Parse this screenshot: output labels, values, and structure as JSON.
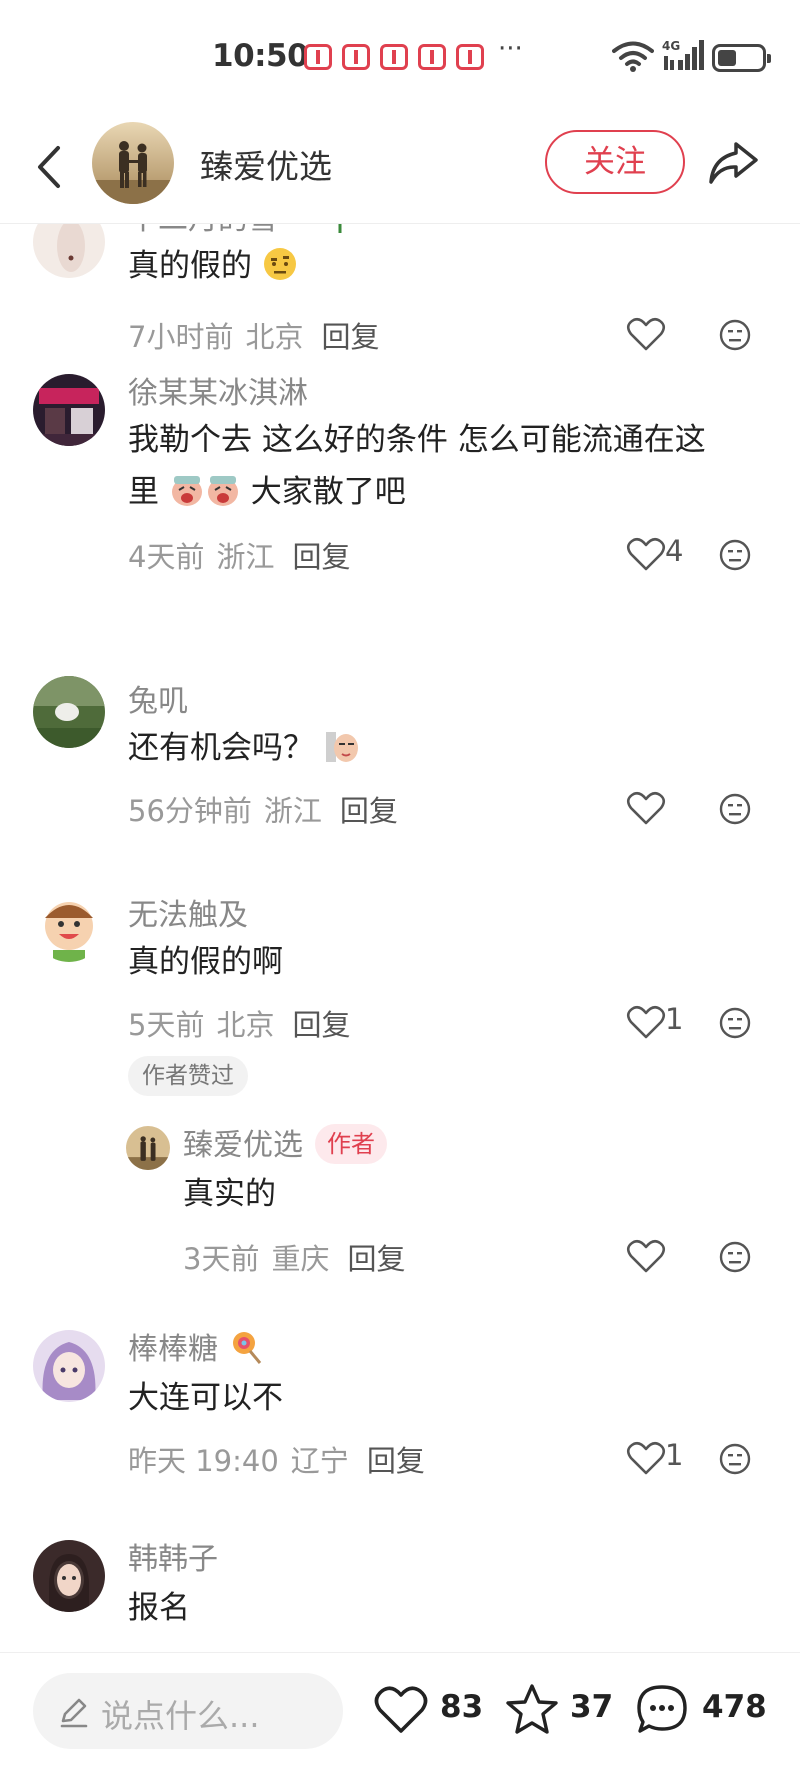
{
  "status_bar": {
    "time": "10:50",
    "dots": "···",
    "network": "4G"
  },
  "header": {
    "account_name": "臻爱优选",
    "follow_label": "关注"
  },
  "comments": [
    {
      "username": "十二月的雪 ~",
      "text": "真的假的",
      "time": "7小时前",
      "location": "北京",
      "reply_label": "回复",
      "likes": ""
    },
    {
      "username": "徐某某冰淇淋",
      "text_line1": "我勒个去 这么好的条件 怎么可能流通在这",
      "text_line2_prefix": "里",
      "text_line2_suffix": " 大家散了吧",
      "time": "4天前",
      "location": "浙江",
      "reply_label": "回复",
      "likes": "4"
    },
    {
      "username": "兔叽",
      "text": "还有机会吗？",
      "time": "56分钟前",
      "location": "浙江",
      "reply_label": "回复",
      "likes": ""
    },
    {
      "username": "无法触及",
      "text": "真的假的啊",
      "time": "5天前",
      "location": "北京",
      "reply_label": "回复",
      "likes": "1",
      "author_liked_label": "作者赞过",
      "reply": {
        "username": "臻爱优选",
        "badge": "作者",
        "text": "真实的",
        "time": "3天前",
        "location": "重庆",
        "reply_label": "回复",
        "likes": ""
      }
    },
    {
      "username": "棒棒糖",
      "text": "大连可以不",
      "time": "昨天 19:40",
      "location": "辽宁",
      "reply_label": "回复",
      "likes": "1"
    },
    {
      "username": "韩韩子",
      "text": "报名"
    }
  ],
  "bottom_bar": {
    "input_placeholder": "说点什么...",
    "likes_count": "83",
    "favorites_count": "37",
    "comments_count": "478"
  },
  "colors": {
    "accent": "#e0404f",
    "muted_text": "#999999",
    "username_text": "#888888",
    "badge_bg": "#fde9ec"
  }
}
